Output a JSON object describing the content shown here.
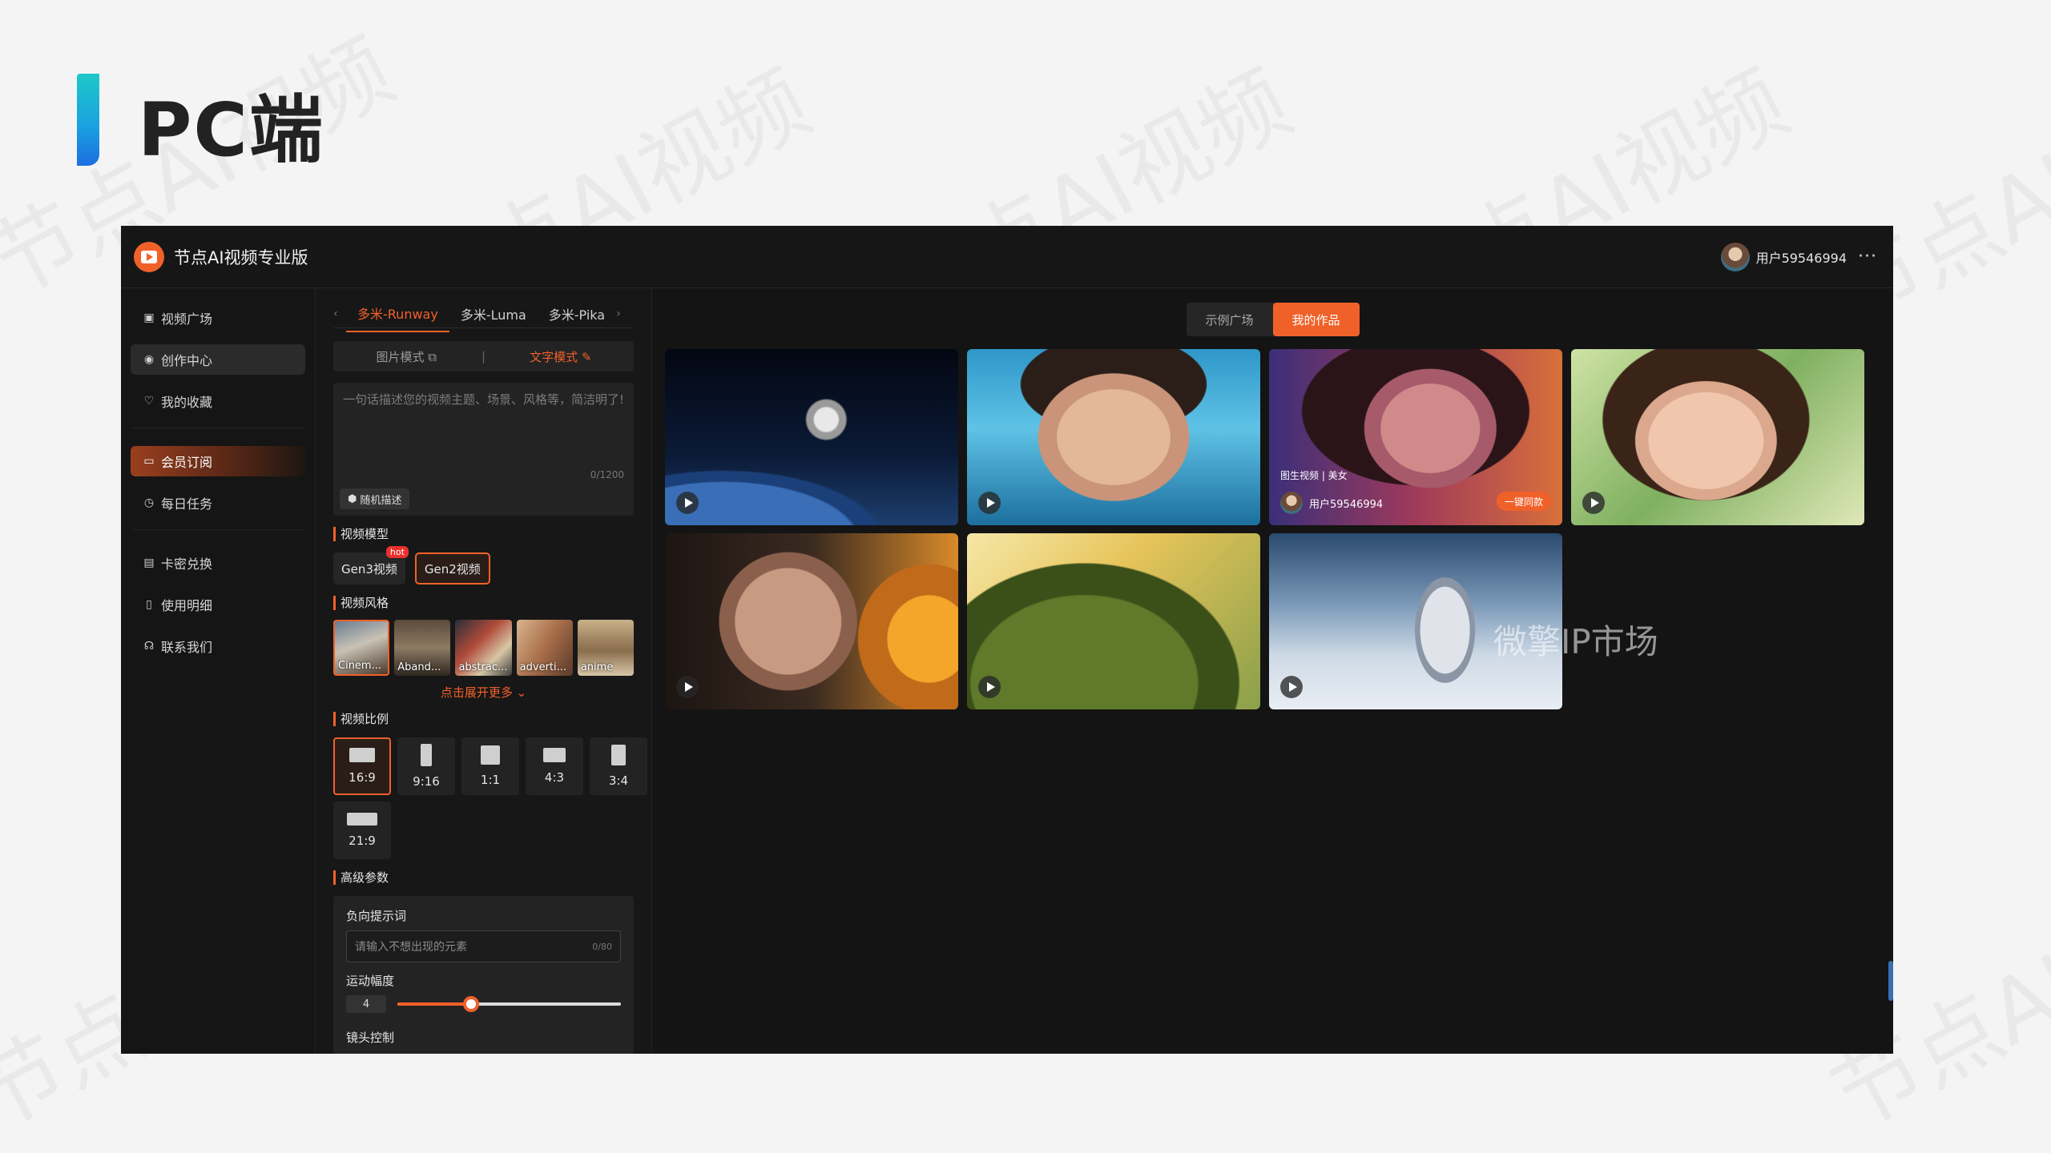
{
  "slide": {
    "title": "PC端",
    "watermark": "节点AI视频"
  },
  "app": {
    "title": "节点AI视频专业版",
    "username": "用户59546994",
    "more": "···"
  },
  "sidebar": {
    "items": [
      {
        "label": "视频广场",
        "icon": "image-icon"
      },
      {
        "label": "创作中心",
        "icon": "create-icon"
      },
      {
        "label": "我的收藏",
        "icon": "heart-icon"
      },
      {
        "label": "会员订阅",
        "icon": "vip-folder-icon"
      },
      {
        "label": "每日任务",
        "icon": "clock-icon"
      },
      {
        "label": "卡密兑换",
        "icon": "card-icon"
      },
      {
        "label": "使用明细",
        "icon": "document-icon"
      },
      {
        "label": "联系我们",
        "icon": "headset-icon"
      }
    ]
  },
  "panel": {
    "model_tabs": [
      "多米-Runway",
      "多米-Luma",
      "多米-Pika"
    ],
    "modes": {
      "image": "图片模式",
      "text": "文字模式"
    },
    "prompt": {
      "placeholder": "一句话描述您的视频主题、场景、风格等，简洁明了!",
      "count": "0/1200",
      "random": "随机描述"
    },
    "video_model_label": "视频模型",
    "models": [
      {
        "label": "Gen3视频",
        "badge": "hot"
      },
      {
        "label": "Gen2视频"
      }
    ],
    "style_label": "视频风格",
    "styles": [
      "Cinem...",
      "Aband...",
      "abstrac...",
      "adverti...",
      "anime"
    ],
    "expand_more": "点击展开更多",
    "ratio_label": "视频比例",
    "ratios": [
      "16:9",
      "9:16",
      "1:1",
      "4:3",
      "3:4",
      "21:9"
    ],
    "advanced_label": "高级参数",
    "negative_prompt_label": "负向提示词",
    "negative_prompt_placeholder": "请输入不想出现的元素",
    "negative_prompt_count": "0/80",
    "motion_label": "运动幅度",
    "motion_value": "4",
    "motion_fraction": 0.33,
    "camera_label": "镜头控制"
  },
  "main": {
    "tabs": [
      "示例广场",
      "我的作品"
    ],
    "cards": [
      {
        "name": "astronaut-earth"
      },
      {
        "name": "girl-underwater"
      },
      {
        "name": "woman-neon",
        "meta": "图生视频 | 美女",
        "user": "用户59546994",
        "action": "一键同款"
      },
      {
        "name": "girl-portrait"
      },
      {
        "name": "woman-paint"
      },
      {
        "name": "watermelon"
      },
      {
        "name": "astronaut-snow"
      }
    ],
    "overlay_watermark": "微擎IP市场"
  },
  "colors": {
    "accent": "#f0612a",
    "app_bg": "#141414",
    "panel_bg": "#171717",
    "slide_bg": "#f4f4f5"
  }
}
